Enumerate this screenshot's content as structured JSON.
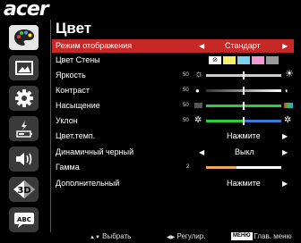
{
  "brand": "acer",
  "menu_title": "Цвет",
  "sidebar": [
    {
      "name": "palette-icon",
      "active": true
    },
    {
      "name": "picture-icon",
      "active": false
    },
    {
      "name": "gear-icon",
      "active": false
    },
    {
      "name": "power-battery-icon",
      "active": false
    },
    {
      "name": "speaker-icon",
      "active": false
    },
    {
      "name": "3d-icon",
      "active": false,
      "text": "3D"
    },
    {
      "name": "language-icon",
      "active": false,
      "text": "ABC"
    }
  ],
  "rows": {
    "display_mode": {
      "label": "Режим отображения",
      "value": "Стандарт"
    },
    "wall_color": {
      "label": "Цвет Стены",
      "swatches": [
        "#ffffff",
        "#f4f06b",
        "#7fd0ee",
        "#f29ad4",
        "#9a9a9a"
      ]
    },
    "brightness": {
      "label": "Яркость",
      "value": "50",
      "level": 50
    },
    "contrast": {
      "label": "Контраст",
      "value": "50",
      "level": 50
    },
    "saturation": {
      "label": "Насыщение",
      "value": "50",
      "level": 50
    },
    "tint": {
      "label": "Уклон",
      "value": "50",
      "level": 50
    },
    "color_temp": {
      "label": "Цвет.темп.",
      "value": "Нажмите"
    },
    "dynamic_black": {
      "label": "Динамичный черный",
      "value": "Выкл"
    },
    "gamma": {
      "label": "Гамма",
      "value": "2",
      "level": 40
    },
    "advanced": {
      "label": "Дополнительный",
      "value": "Нажмите"
    }
  },
  "footer": {
    "select_label": "Выбрать",
    "adjust_label": "Регулир.",
    "menu_key": "МЕНЮ",
    "menu_label": "Глав. меню"
  },
  "colors": {
    "selected_row": "#c62828",
    "saturation_bar": "#2ecc40",
    "tint_bar_left": "#2ecc40",
    "tint_bar_right": "#3a7bd5",
    "gamma_bar": "#f0a860"
  }
}
